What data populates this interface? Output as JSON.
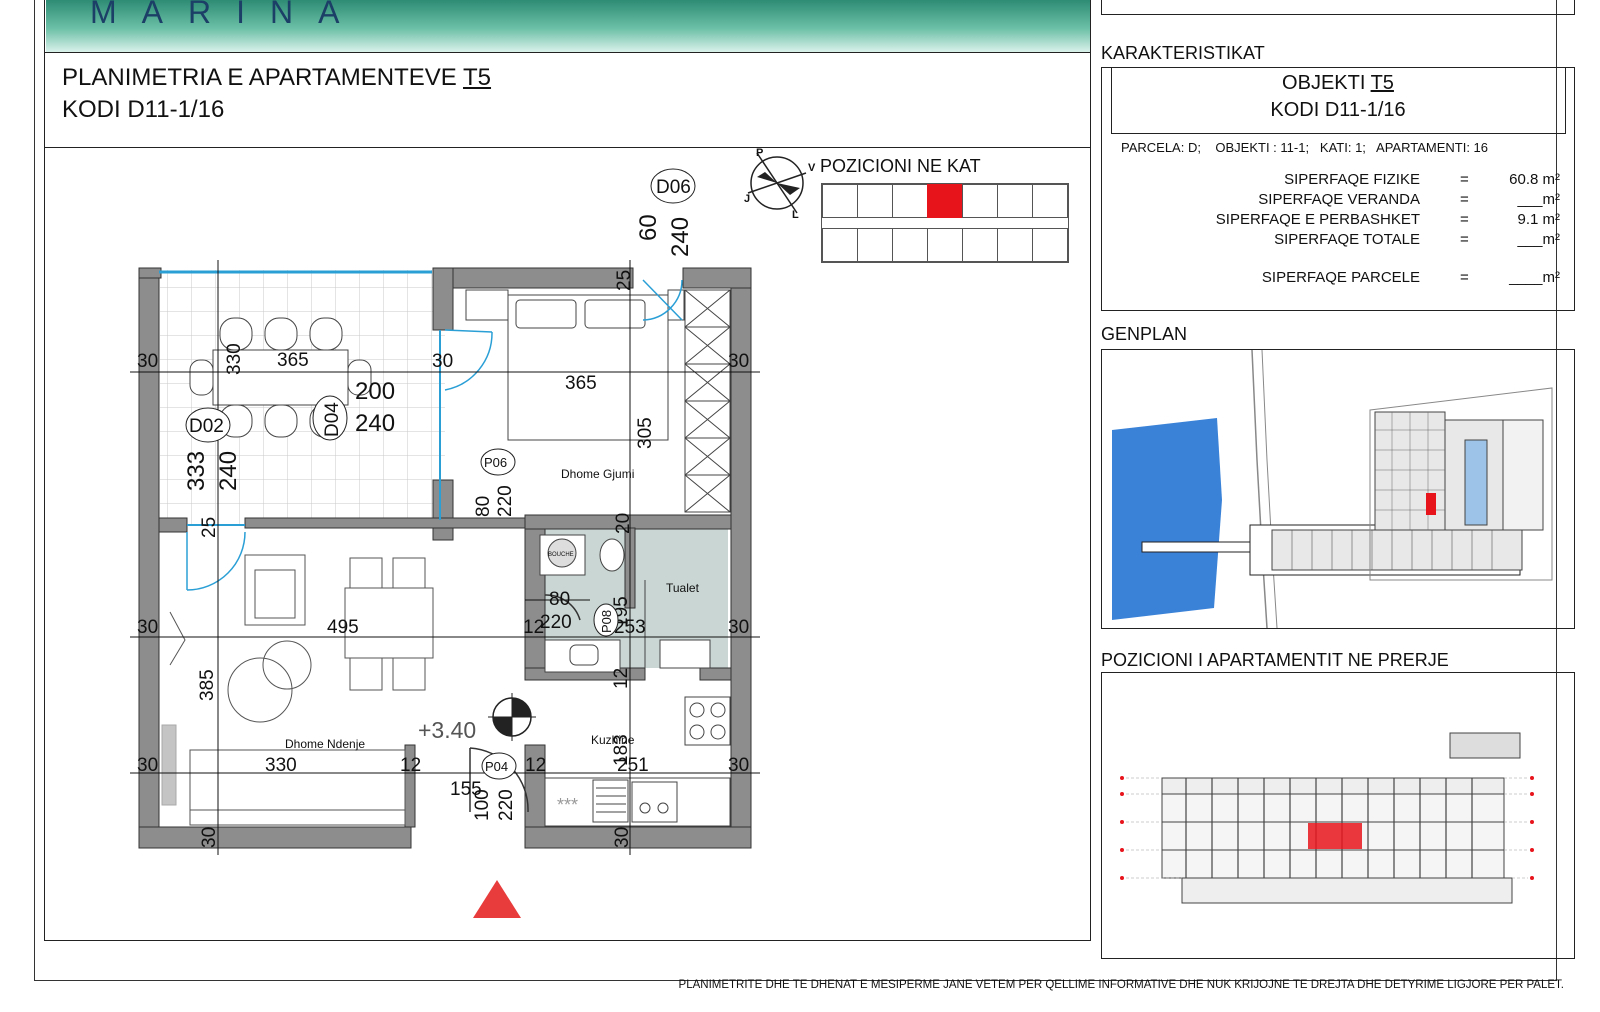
{
  "header": {
    "logo": "MARINA",
    "title_prefix": "PLANIMETRIA E APARTAMENTEVE ",
    "title_unit": "T5",
    "code": "KODI D11-1/16"
  },
  "floorplan": {
    "position_label": "POZICIONI NE KAT",
    "compass_letters": [
      "P",
      "V",
      "J",
      "L"
    ],
    "level": "+3.40",
    "rooms": {
      "bedroom": "Dhome Gjumi",
      "toilet": "Tualet",
      "living": "Dhome Ndenje",
      "kitchen": "Kuzhine"
    },
    "tags": {
      "d06": "D06",
      "d02": "D02",
      "d04": "D04",
      "p06": "P06",
      "p08": "P08",
      "p04": "P04"
    },
    "washer": "BOUCHE"
  },
  "dims": {
    "d_30": "30",
    "d_365": "365",
    "d_330": "330",
    "d_200": "200",
    "d_240": "240",
    "d_333": "333",
    "d_25": "25",
    "d_60": "60",
    "d_305": "305",
    "d_80": "80",
    "d_220": "220",
    "d_20": "20",
    "d_195": "195",
    "d_495": "495",
    "d_12": "12",
    "d_253": "253",
    "d_385": "385",
    "d_183": "183",
    "d_251": "251",
    "d_155": "155",
    "d_100": "100",
    "stars": "***"
  },
  "characteristics": {
    "heading": "KARAKTERISTIKAT",
    "object_prefix": "OBJEKTI ",
    "object_unit": "T5",
    "code": "KODI D11-1/16",
    "parcel_line": "PARCELA: D;    OBJEKTI : 11-1;   KATI: 1;   APARTAMENTI: 16",
    "rows": [
      {
        "label": "SIPERFAQE  FIZIKE",
        "eq": "=",
        "value": "60.8 m²"
      },
      {
        "label": "SIPERFAQE  VERANDA",
        "eq": "=",
        "value": "___m²"
      },
      {
        "label": "SIPERFAQE E PERBASHKET",
        "eq": "=",
        "value": "9.1 m²"
      },
      {
        "label": "SIPERFAQE TOTALE",
        "eq": "=",
        "value": "___m²"
      },
      {
        "label": "SIPERFAQE PARCELE",
        "eq": "=",
        "value": "____m²"
      }
    ]
  },
  "genplan": {
    "heading": "GENPLAN"
  },
  "section": {
    "heading": "POZICIONI I APARTAMENTIT NE PRERJE"
  },
  "footer": {
    "disclaimer": "PLANIMETRITE DHE TE DHENAT E MESIPERME JANE VETEM PER QELLIME INFORMATIVE DHE NUK KRIJOJNE TE DREJTA DHE DETYRIME LIGJORE PER PALET."
  },
  "colors": {
    "highlight": "#e8141c",
    "header_green": "#4aa88c",
    "logo": "#1b3f66",
    "water": "#2f7bd6",
    "toilet_fill": "#c9d6d3",
    "door_swing": "#2a9fd6",
    "entry_arrow": "#e83c3c"
  }
}
